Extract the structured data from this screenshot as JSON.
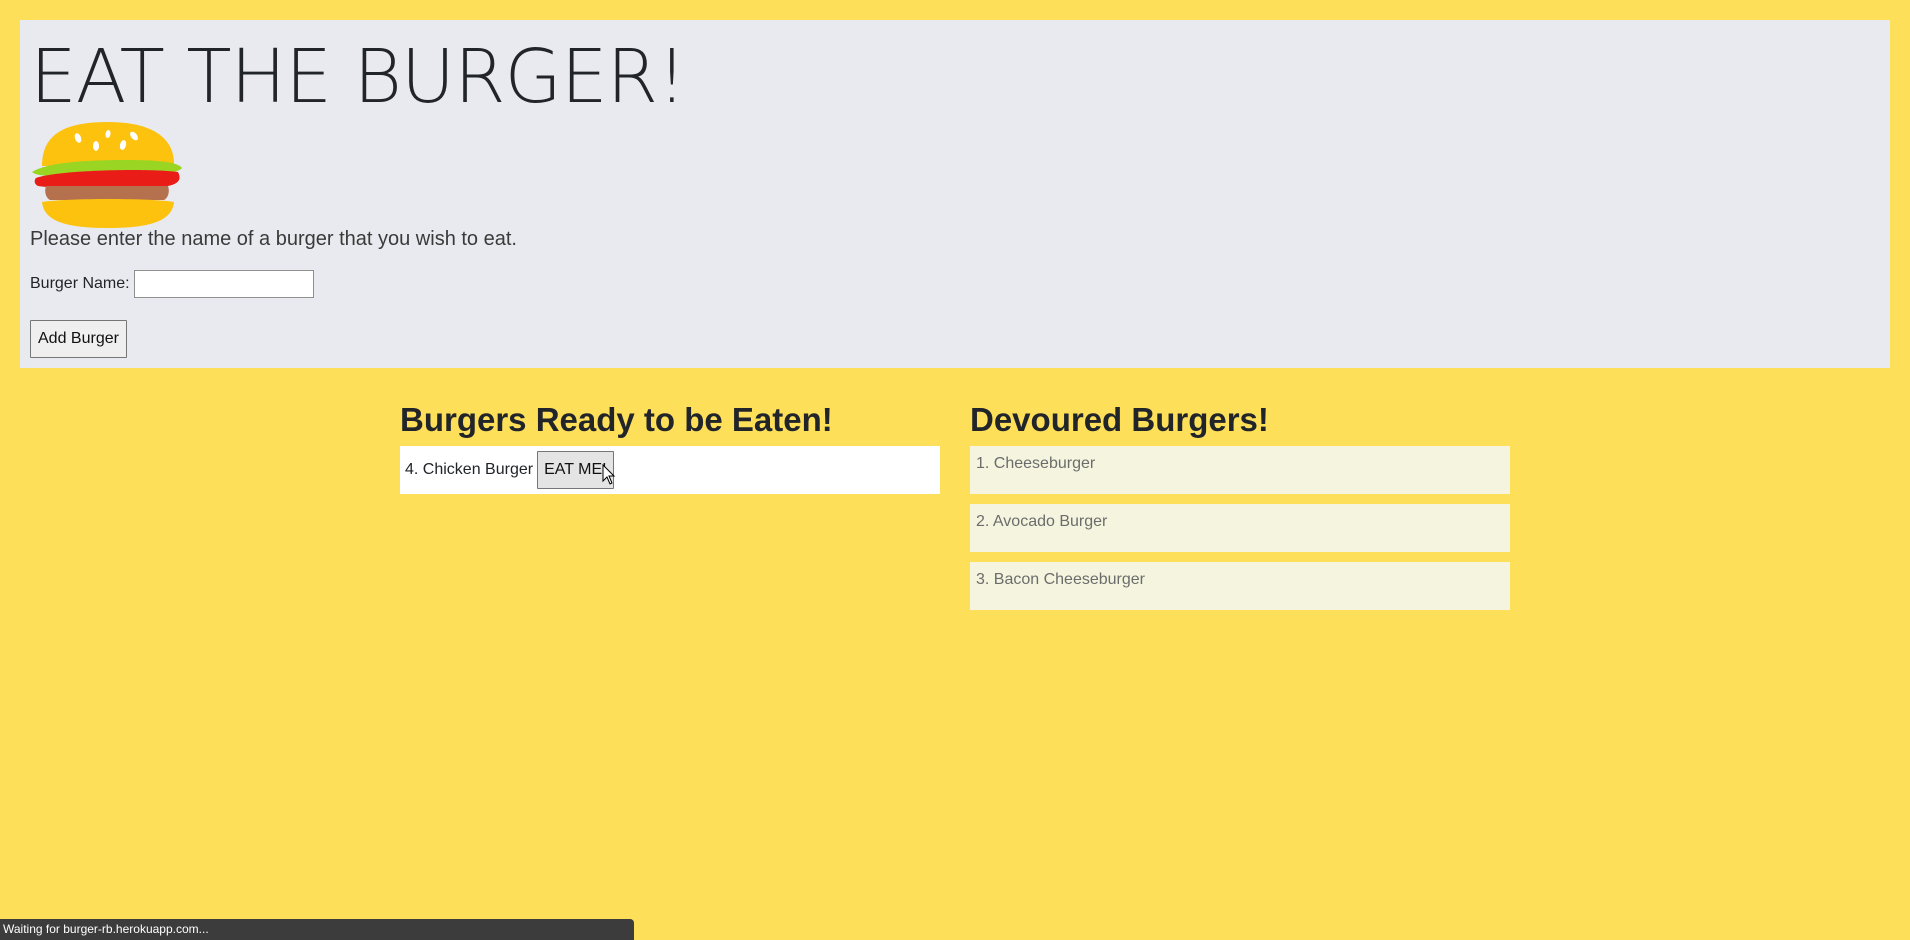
{
  "header": {
    "title": "EAT THE BURGER!",
    "prompt": "Please enter the name of a burger that you wish to eat.",
    "burger_name_label": "Burger Name:",
    "burger_name_value": "",
    "add_button_label": "Add Burger",
    "logo_icon": "burger-icon"
  },
  "ready": {
    "heading": "Burgers Ready to be Eaten!",
    "items": [
      {
        "label": "4. Chicken Burger",
        "button_label": "EAT ME!"
      }
    ]
  },
  "devoured": {
    "heading": "Devoured Burgers!",
    "items": [
      {
        "label": "1. Cheeseburger"
      },
      {
        "label": "2. Avocado Burger"
      },
      {
        "label": "3. Bacon Cheeseburger"
      }
    ]
  },
  "status_bar": {
    "text": "Waiting for burger-rb.herokuapp.com..."
  },
  "colors": {
    "page_background": "#fddf59",
    "jumbotron_background": "#e9eaef",
    "devoured_background": "#f5f5df"
  }
}
